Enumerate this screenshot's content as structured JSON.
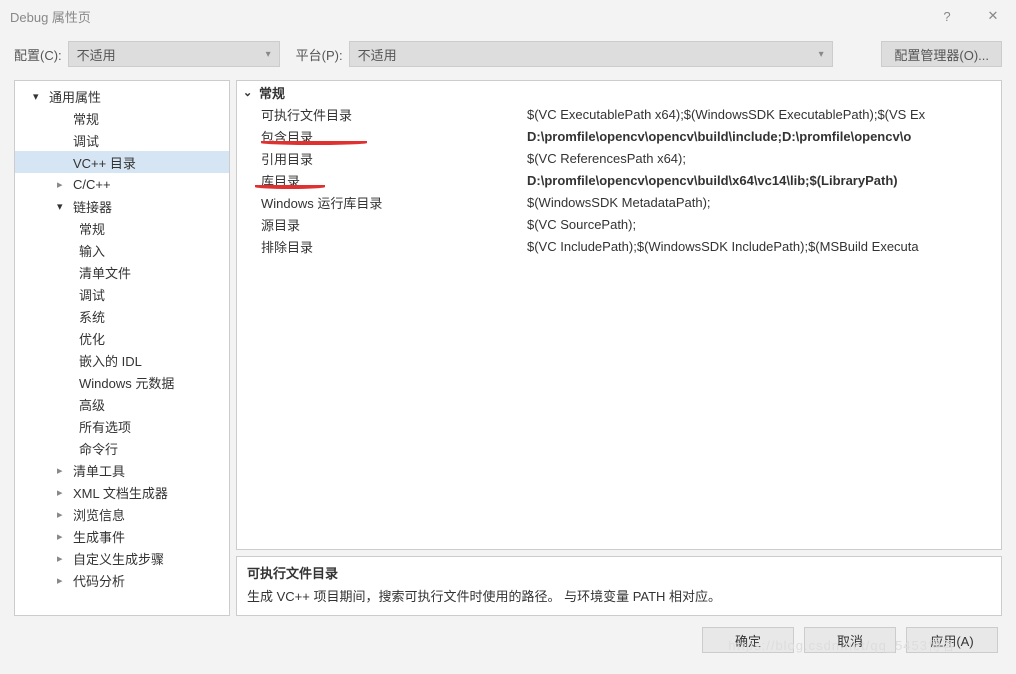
{
  "window": {
    "title": "Debug 属性页"
  },
  "toolbar": {
    "config_label": "配置(C):",
    "config_value": "不适用",
    "platform_label": "平台(P):",
    "platform_value": "不适用",
    "manager_btn": "配置管理器(O)..."
  },
  "tree": {
    "root": "通用属性",
    "items_lvl2": [
      {
        "label": "常规",
        "arrow": ""
      },
      {
        "label": "调试",
        "arrow": ""
      },
      {
        "label": "VC++ 目录",
        "arrow": "",
        "selected": true
      },
      {
        "label": "C/C++",
        "arrow": "closed"
      },
      {
        "label": "链接器",
        "arrow": "open"
      }
    ],
    "linker_children": [
      "常规",
      "输入",
      "清单文件",
      "调试",
      "系统",
      "优化",
      "嵌入的 IDL",
      "Windows 元数据",
      "高级",
      "所有选项",
      "命令行"
    ],
    "items_after": [
      {
        "label": "清单工具",
        "arrow": "closed"
      },
      {
        "label": "XML 文档生成器",
        "arrow": "closed"
      },
      {
        "label": "浏览信息",
        "arrow": "closed"
      },
      {
        "label": "生成事件",
        "arrow": "closed"
      },
      {
        "label": "自定义生成步骤",
        "arrow": "closed"
      },
      {
        "label": "代码分析",
        "arrow": "closed"
      }
    ]
  },
  "grid": {
    "section": "常规",
    "rows": [
      {
        "label": "可执行文件目录",
        "value": "$(VC ExecutablePath x64);$(WindowsSDK ExecutablePath);$(VS Ex",
        "bold": false
      },
      {
        "label": "包含目录",
        "value": "D:\\promfile\\opencv\\opencv\\build\\include;D:\\promfile\\opencv\\o",
        "bold": true
      },
      {
        "label": "引用目录",
        "value": "$(VC ReferencesPath x64);",
        "bold": false
      },
      {
        "label": "库目录",
        "value": "D:\\promfile\\opencv\\opencv\\build\\x64\\vc14\\lib;$(LibraryPath)",
        "bold": true
      },
      {
        "label": "Windows 运行库目录",
        "value": "$(WindowsSDK MetadataPath);",
        "bold": false
      },
      {
        "label": "源目录",
        "value": "$(VC SourcePath);",
        "bold": false
      },
      {
        "label": "排除目录",
        "value": "$(VC IncludePath);$(WindowsSDK IncludePath);$(MSBuild Executa",
        "bold": false
      }
    ]
  },
  "description": {
    "title": "可执行文件目录",
    "text": "生成 VC++ 项目期间，搜索可执行文件时使用的路径。  与环境变量 PATH 相对应。"
  },
  "buttons": {
    "ok": "确定",
    "cancel": "取消",
    "apply": "应用(A)"
  },
  "watermark": "https://blog.csdn.net/qq_5453博客"
}
